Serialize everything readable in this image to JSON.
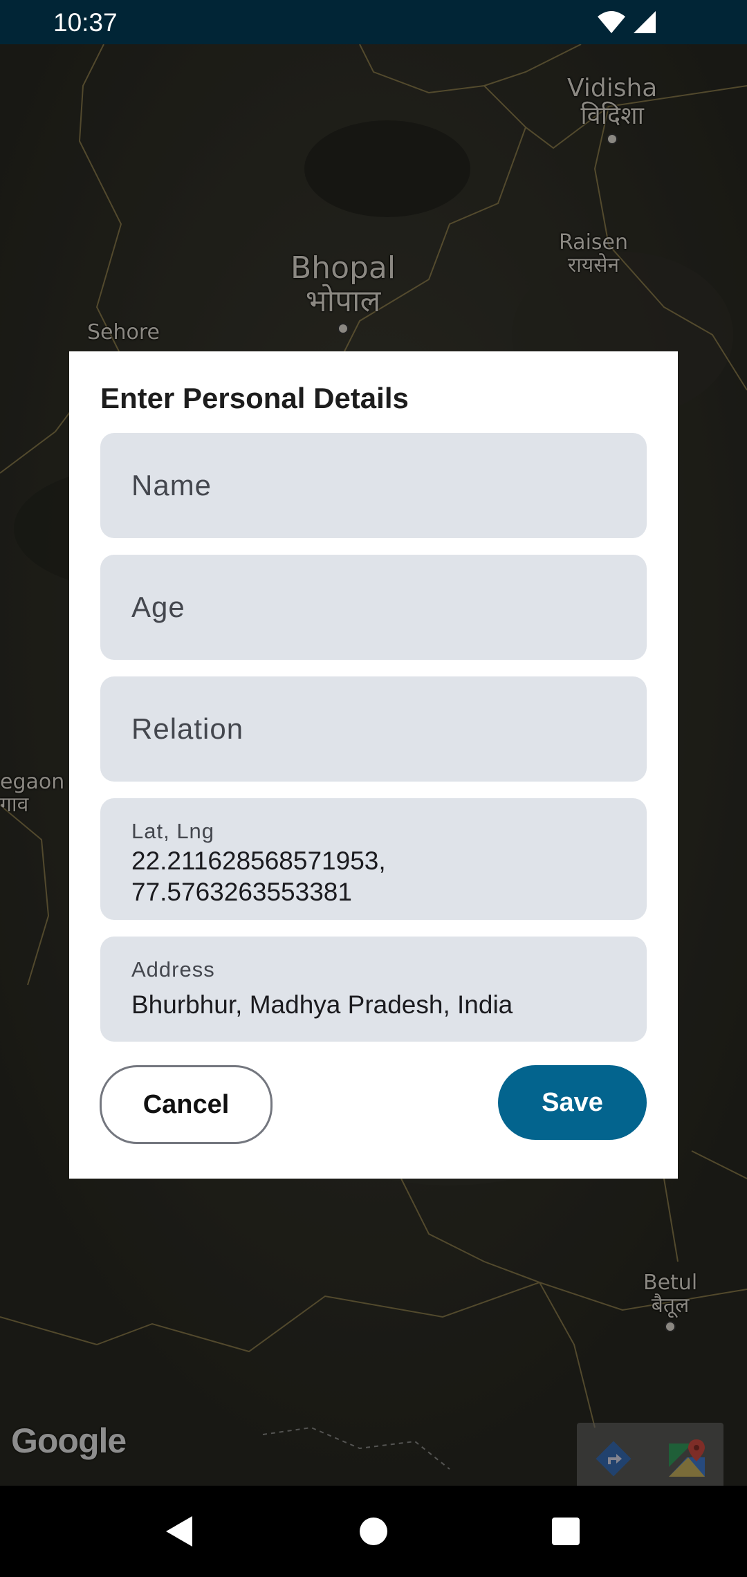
{
  "status_bar": {
    "time": "10:37"
  },
  "map": {
    "cities": [
      {
        "en": "Vidisha",
        "local": "विदिशा"
      },
      {
        "en": "Raisen",
        "local": "रायसेन"
      },
      {
        "en": "Bhopal",
        "local": "भोपाल"
      },
      {
        "en": "Sehore",
        "local": ""
      },
      {
        "en": "egaon",
        "local": "गाव"
      },
      {
        "en": "Betul",
        "local": "बैतूल"
      }
    ],
    "logo": "Google",
    "toolbar": [
      "directions-icon",
      "google-maps-icon"
    ]
  },
  "dialog": {
    "title": "Enter Personal Details",
    "name_placeholder": "Name",
    "age_placeholder": "Age",
    "relation_placeholder": "Relation",
    "latlng_label": "Lat, Lng",
    "latlng_value_line1": "22.211628568571953,",
    "latlng_value_line2": "77.5763263553381",
    "address_label": "Address",
    "address_value": "Bhurbhur, Madhya Pradesh, India",
    "cancel_label": "Cancel",
    "save_label": "Save"
  },
  "colors": {
    "status_bar": "#012536",
    "field_bg": "#dfe3e9",
    "save_button": "#03648e"
  }
}
